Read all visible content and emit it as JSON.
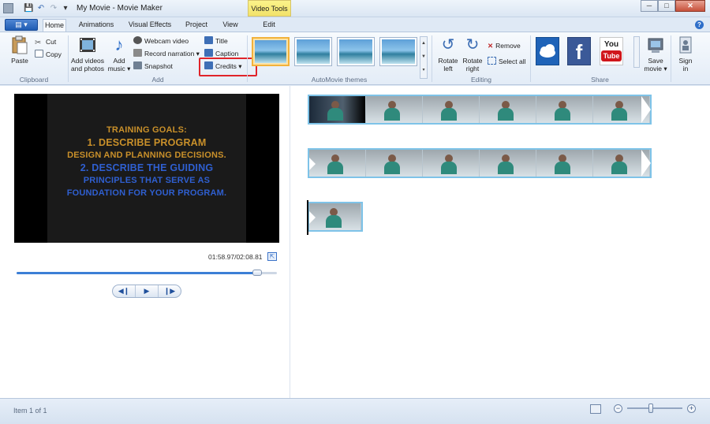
{
  "window": {
    "title": "My Movie - Movie Maker",
    "context_tab_group": "Video Tools",
    "controls": {
      "minimize": "─",
      "maximize": "□",
      "close": "✕"
    }
  },
  "qat": {
    "save": "💾",
    "undo": "↶",
    "redo": "↷",
    "customize": "▾"
  },
  "tabs": {
    "file_button": "▤ ▾",
    "items": [
      "Home",
      "Animations",
      "Visual Effects",
      "Project",
      "View",
      "Edit"
    ],
    "active": "Home",
    "help": "?"
  },
  "ribbon": {
    "clipboard": {
      "label": "Clipboard",
      "paste": "Paste",
      "cut": "Cut",
      "copy": "Copy"
    },
    "add": {
      "label": "Add",
      "add_videos": "Add videos\nand photos",
      "add_videos_l1": "Add videos",
      "add_videos_l2": "and photos",
      "add_music_l1": "Add",
      "add_music_l2": "music ▾",
      "webcam": "Webcam video",
      "record": "Record narration ▾",
      "snapshot": "Snapshot",
      "title": "Title",
      "caption": "Caption",
      "credits": "Credits ▾",
      "highlight_color": "#e0242a"
    },
    "themes": {
      "label": "AutoMovie themes",
      "count": 4,
      "selected_index": 0,
      "scroll_up": "▲",
      "scroll_down": "▼",
      "more": "▾"
    },
    "editing": {
      "label": "Editing",
      "rotate_left_l1": "Rotate",
      "rotate_left_l2": "left",
      "rotate_right_l1": "Rotate",
      "rotate_right_l2": "right",
      "remove": "Remove",
      "select_all": "Select all"
    },
    "share": {
      "label": "Share",
      "youtube_l1": "You",
      "youtube_l2": "Tube",
      "save_movie_l1": "Save",
      "save_movie_l2": "movie ▾",
      "sign_in_l1": "Sign",
      "sign_in_l2": "in"
    }
  },
  "preview": {
    "line1": "TRAINING GOALS:",
    "line2": "1. DESCRIBE PROGRAM",
    "line3": "DESIGN AND PLANNING DECISIONS.",
    "line4": "2. DESCRIBE THE GUIDING",
    "line5": "PRINCIPLES THAT SERVE AS",
    "line6": "FOUNDATION FOR YOUR PROGRAM.",
    "color_gold": "#c9902a",
    "color_blue": "#2f5fd0",
    "timecode": "01:58.97/02:08.81",
    "progress": 0.924,
    "fullscreen_icon": "⇱",
    "transport": {
      "prev": "◀❙",
      "play": "▶",
      "next": "❙▶"
    }
  },
  "storyboard": {
    "clips": [
      {
        "frames": 6,
        "first_frame_dark": true
      },
      {
        "frames": 6,
        "first_frame_dark": false
      },
      {
        "frames": 1,
        "first_frame_dark": false
      }
    ]
  },
  "statusbar": {
    "text": "Item 1 of 1",
    "zoom_minus": "−",
    "zoom_plus": "+",
    "zoom_level": 0.43
  }
}
